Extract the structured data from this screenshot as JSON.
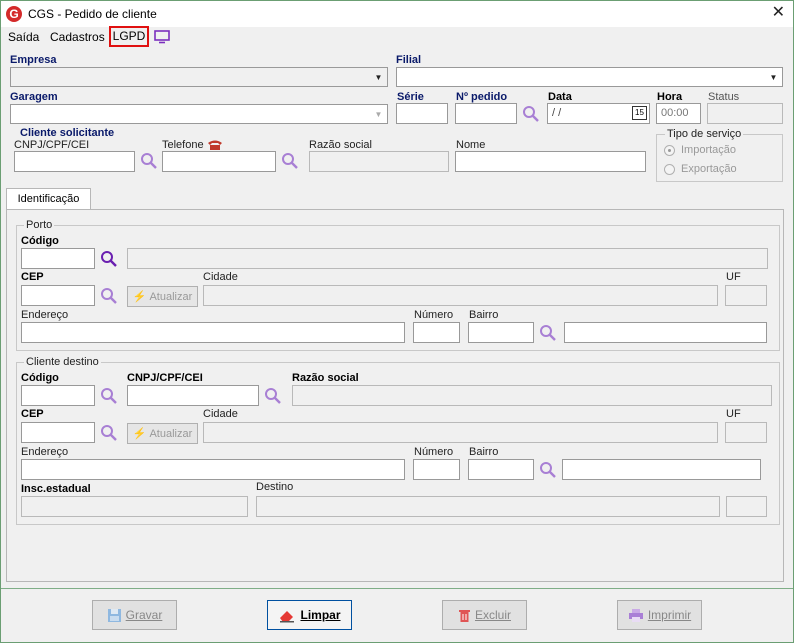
{
  "window": {
    "title": "CGS - Pedido de cliente"
  },
  "menu": {
    "saida": "Saída",
    "cadastros": "Cadastros",
    "lgpd": "LGPD"
  },
  "header": {
    "empresa_label": "Empresa",
    "filial_label": "Filial",
    "garagem_label": "Garagem",
    "serie_label": "Série",
    "pedido_label": "Nº pedido",
    "data_label": "Data",
    "data_value": "/  /",
    "calendar_day": "15",
    "hora_label": "Hora",
    "hora_value": "00:00",
    "status_label": "Status"
  },
  "cliente_solicitante": {
    "title": "Cliente solicitante",
    "cnpj_label": "CNPJ/CPF/CEI",
    "telefone_label": "Telefone",
    "razao_label": "Razão social",
    "nome_label": "Nome"
  },
  "tipo_servico": {
    "title": "Tipo de serviço",
    "options": [
      "Importação",
      "Exportação"
    ],
    "selected": "Importação"
  },
  "tabs": [
    {
      "label": "Identificação",
      "active": true
    }
  ],
  "porto": {
    "title": "Porto",
    "codigo_label": "Código",
    "cep_label": "CEP",
    "atualizar_label": "Atualizar",
    "cidade_label": "Cidade",
    "uf_label": "UF",
    "endereco_label": "Endereço",
    "numero_label": "Número",
    "bairro_label": "Bairro"
  },
  "cliente_destino": {
    "title": "Cliente destino",
    "codigo_label": "Código",
    "cnpj_label": "CNPJ/CPF/CEI",
    "razao_label": "Razão social",
    "cep_label": "CEP",
    "atualizar_label": "Atualizar",
    "cidade_label": "Cidade",
    "uf_label": "UF",
    "endereco_label": "Endereço",
    "numero_label": "Número",
    "bairro_label": "Bairro",
    "insc_label": "Insc.estadual",
    "destino_label": "Destino"
  },
  "buttons": {
    "gravar": "Gravar",
    "limpar": "Limpar",
    "excluir": "Excluir",
    "imprimir": "Imprimir"
  },
  "colors": {
    "accent": "#7b2fbe",
    "lgpd_border": "#e01010",
    "label_blue": "#0a1a6a"
  }
}
